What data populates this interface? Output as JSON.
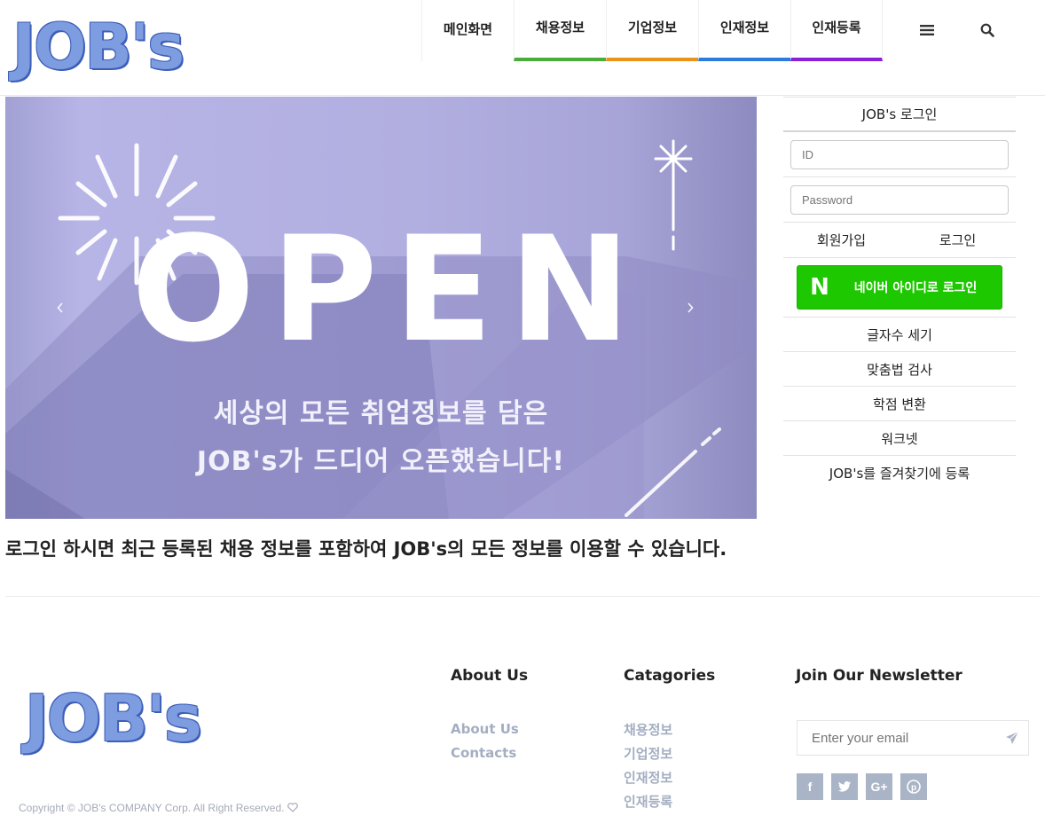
{
  "brand": {
    "logo_text": "JOB's",
    "logo_color": "#7e9de0",
    "logo_outline": "#3d5fb8"
  },
  "nav": {
    "items": [
      {
        "label": "메인화면",
        "underline": ""
      },
      {
        "label": "채용정보",
        "underline": "#4aad3b"
      },
      {
        "label": "기업정보",
        "underline": "#e9921c"
      },
      {
        "label": "인재정보",
        "underline": "#2e7be0"
      },
      {
        "label": "인재등록",
        "underline": "#8a1fd8"
      }
    ],
    "menu_icon": "hamburger-icon",
    "search_icon": "search-icon"
  },
  "hero": {
    "headline": "OPEN",
    "line1": "세상의 모든 취업정보를 담은",
    "line2": "JOB's가 드디어 오픈했습니다!",
    "prev_icon": "chevron-left-icon",
    "next_icon": "chevron-right-icon"
  },
  "login": {
    "title": "JOB's 로그인",
    "id_placeholder": "ID",
    "password_placeholder": "Password",
    "signup_label": "회원가입",
    "login_label": "로그인",
    "naver_label": "네이버 아이디로 로그인",
    "naver_logo": "N",
    "naver_color": "#1ec800"
  },
  "side_links": [
    "글자수 세기",
    "맞춤법 검사",
    "학점 변환",
    "워크넷",
    "JOB's를 즐겨찾기에 등록"
  ],
  "notice": "로그인 하시면 최근 등록된 채용 정보를 포함하여 JOB's의 모든 정보를 이용할 수 있습니다.",
  "footer": {
    "about_heading": "About Us",
    "about_links": [
      "About Us",
      "Contacts"
    ],
    "categories_heading": "Catagories",
    "category_links": [
      "채용정보",
      "기업정보",
      "인재정보",
      "인재등록"
    ],
    "newsletter_heading": "Join Our Newsletter",
    "email_placeholder": "Enter your email",
    "send_icon": "paper-plane-icon",
    "social": [
      {
        "icon": "facebook-icon",
        "glyph": "f"
      },
      {
        "icon": "twitter-icon",
        "glyph": "t"
      },
      {
        "icon": "google-plus-icon",
        "glyph": "G+"
      },
      {
        "icon": "pinterest-icon",
        "glyph": "p"
      }
    ],
    "copyright": "Copyright © JOB's COMPANY Corp. All Right Reserved."
  }
}
